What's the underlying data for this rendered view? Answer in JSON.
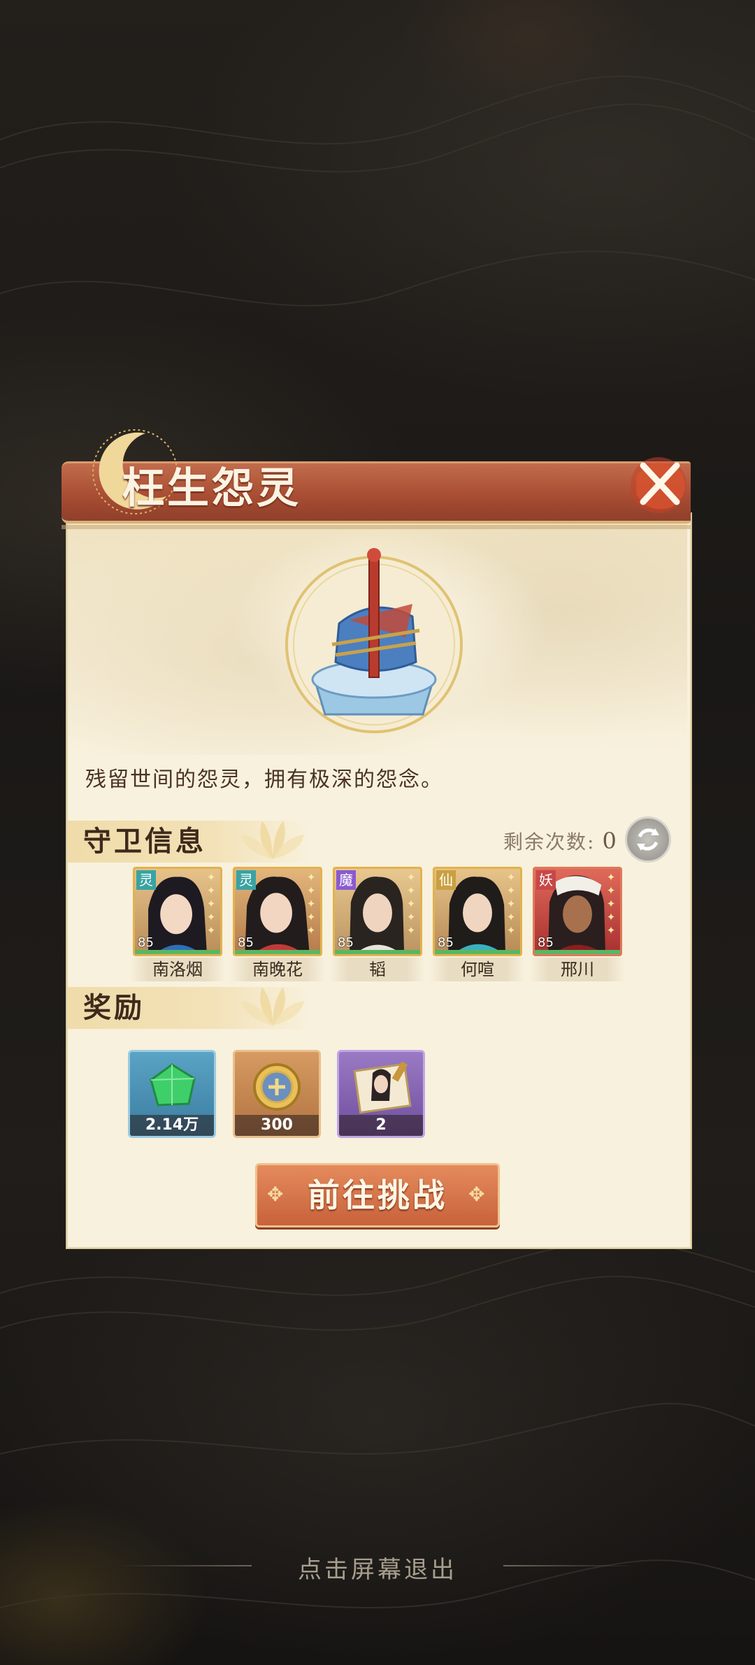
{
  "dialog": {
    "title": "枉生怨灵",
    "description": "残留世间的怨灵，拥有极深的怨念。"
  },
  "guard_section": {
    "title": "守卫信息",
    "remaining_label": "剩余次数:",
    "remaining_value": "0",
    "heroes": [
      {
        "name": "南洛烟",
        "level": "85",
        "tag": "灵",
        "tag_color": "#3aa3a3"
      },
      {
        "name": "南晚花",
        "level": "85",
        "tag": "灵",
        "tag_color": "#3aa3a3"
      },
      {
        "name": "韬",
        "level": "85",
        "tag": "魔",
        "tag_color": "#8a5ad0"
      },
      {
        "name": "何喧",
        "level": "85",
        "tag": "仙",
        "tag_color": "#c9a040"
      },
      {
        "name": "邢川",
        "level": "85",
        "tag": "妖",
        "tag_color": "#c84848"
      }
    ]
  },
  "reward_section": {
    "title": "奖励",
    "items": [
      {
        "icon": "green-jade-icon",
        "count": "2.14万"
      },
      {
        "icon": "gold-coin-icon",
        "count": "300"
      },
      {
        "icon": "portrait-scroll-icon",
        "count": "2"
      }
    ]
  },
  "challenge_button": "前往挑战",
  "exit_hint": "点击屏幕退出",
  "colors": {
    "title_bar": "#a94e34",
    "panel": "#f8f1dd",
    "button": "#d06e45"
  }
}
